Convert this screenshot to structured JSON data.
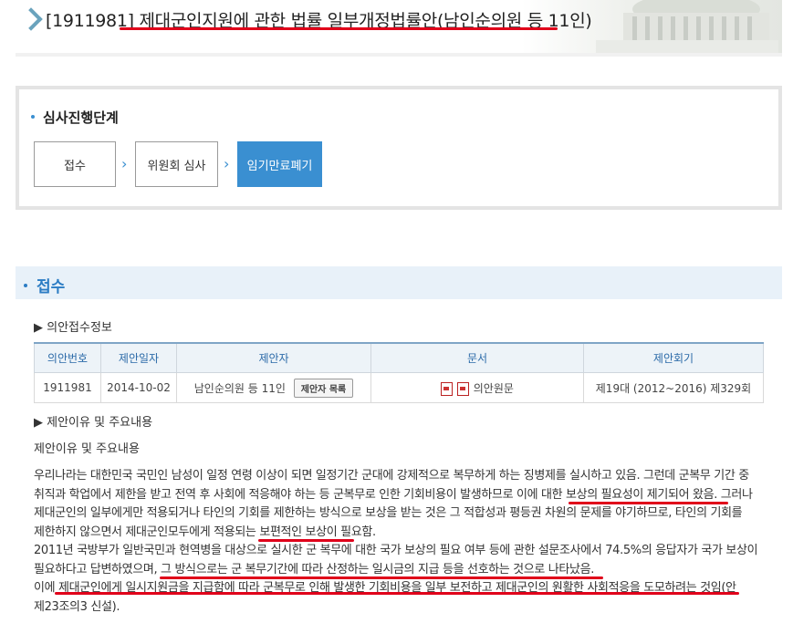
{
  "header": {
    "title": "[1911981] 제대군인지원에 관한 법률 일부개정법률안(남인순의원 등 11인)"
  },
  "progress": {
    "title": "심사진행단계",
    "steps": [
      "접수",
      "위원회 심사",
      "임기만료폐기"
    ],
    "active_step": 2,
    "arrow": "›"
  },
  "reception": {
    "section_title": "접수",
    "info_title": "▶ 의안접수정보",
    "table": {
      "headers": [
        "의안번호",
        "제안일자",
        "제안자",
        "문서",
        "제안회기"
      ],
      "row": {
        "bill_no": "1911981",
        "date": "2014-10-02",
        "proposer": "남인순의원 등 11인",
        "proposer_button": "제안자 목록",
        "document": "의안원문",
        "session": "제19대 (2012~2016) 제329회"
      }
    },
    "reason_header": "▶ 제안이유 및 주요내용",
    "reason_title": "제안이유 및 주요내용",
    "paragraphs": [
      "우리나라는 대한민국 국민인 남성이 일정 연령 이상이 되면 일정기간 군대에 강제적으로 복무하게 하는 징병제를 실시하고 있음. 그런데 군복무 기간 중 취직과 학업에서 제한을 받고 전역 후 사회에 적응해야 하는 등 군복무로 인한 기회비용이 발생하므로 이에 대한 보상의 필요성이 제기되어 왔음. 그러나 제대군인의 일부에게만 적용되거나 타인의 기회를 제한하는 방식으로 보상을 받는 것은 그 적합성과 평등권 차원의 문제를 야기하므로, 타인의 기회를 제한하지 않으면서 제대군인모두에게 적용되는 보편적인 보상이 필요함.",
      "2011년 국방부가 일반국민과 현역병을 대상으로 실시한 군 복무에 대한 국가 보상의 필요 여부 등에 관한 설문조사에서 74.5%의 응답자가 국가 보상이 필요하다고 답변하였으며, 그 방식으로는 군 복무기간에 따라 산정하는 일시금의 지급 등을 선호하는 것으로 나타났음.",
      "이에 제대군인에게 일시지원금을 지급함에 따라 군복무로 인해 발생한 기회비용을 일부 보전하고 제대군인의 원활한 사회적응을 도모하려는 것임(안 제23조의3 신설)."
    ]
  },
  "colors": {
    "accent": "#3a8fd1",
    "section_text": "#2b7cc4",
    "section_bg": "#e8f1f9",
    "underline": "#e0001a"
  },
  "icons": [
    "chevron-right-icon",
    "hwp-file-icon",
    "pdf-file-icon"
  ]
}
